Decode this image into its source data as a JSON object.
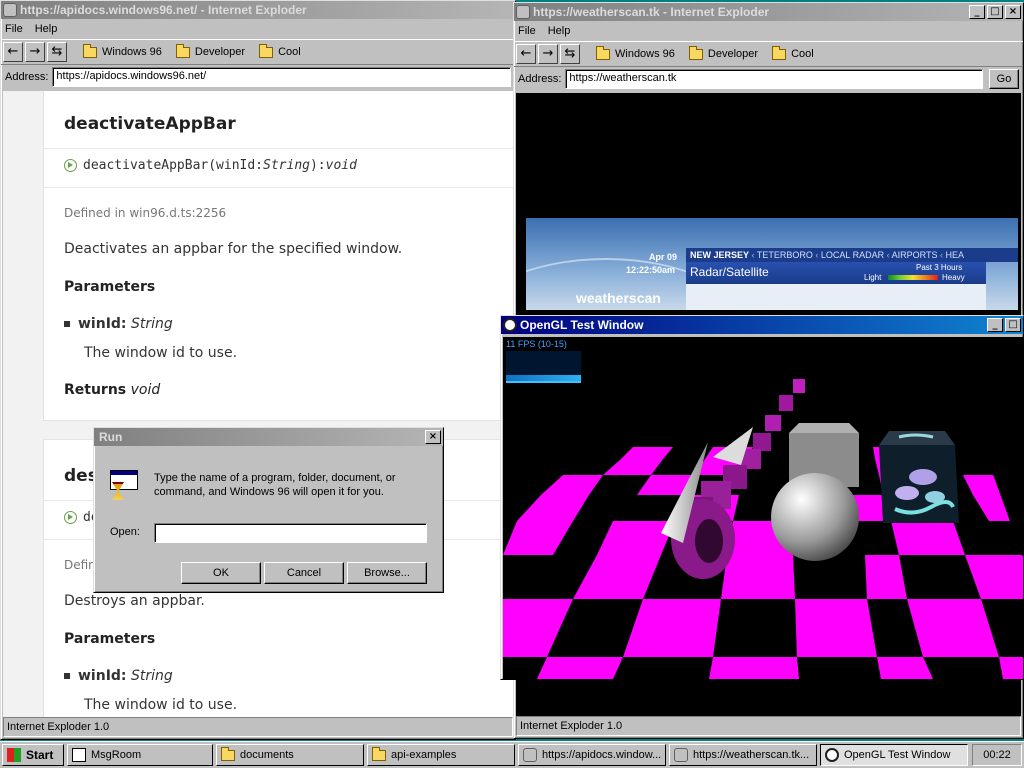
{
  "docs_window": {
    "title": "https://apidocs.windows96.net/ - Internet Exploder",
    "menu": [
      "File",
      "Help"
    ],
    "links": [
      "Windows 96",
      "Developer",
      "Cool"
    ],
    "address_label": "Address:",
    "address": "https://apidocs.windows96.net/",
    "status": "Internet Exploder 1.0",
    "card1": {
      "heading": "deactivateAppBar",
      "sig_name": "deactivateAppBar(winId: ",
      "sig_type": "String",
      "sig_mid": "): ",
      "sig_ret": "void",
      "defined": "Defined in win96.d.ts:2256",
      "desc": "Deactivates an appbar for the specified window.",
      "params_heading": "Parameters",
      "param_name": "winId:",
      "param_type": "String",
      "param_desc": "The window id to use.",
      "returns_label": "Returns",
      "returns_type": "void"
    },
    "card2": {
      "heading_partial": "dest",
      "sig_partial": "de",
      "defined_partial": "Defin",
      "desc": "Destroys an appbar.",
      "params_heading": "Parameters",
      "param_name": "winId:",
      "param_type": "String",
      "param_desc": "The window id to use."
    }
  },
  "weather_window": {
    "title": "https://weatherscan.tk - Internet Exploder",
    "menu": [
      "File",
      "Help"
    ],
    "links": [
      "Windows 96",
      "Developer",
      "Cool"
    ],
    "address_label": "Address:",
    "address": "https://weatherscan.tk",
    "go_label": "Go",
    "status": "Internet Exploder 1.0",
    "banner": {
      "date": "Apr 09",
      "time": "12:22:50am",
      "logo": "weatherscan",
      "location": "NEW JERSEY",
      "crumbs": [
        "TETERBORO",
        "LOCAL RADAR",
        "AIRPORTS",
        "HEA"
      ],
      "panel_title": "Radar/Satellite",
      "past_hours": "Past 3 Hours",
      "light": "Light",
      "heavy": "Heavy"
    }
  },
  "gl_window": {
    "title": "OpenGL Test Window",
    "fps": "11 FPS (10-15)"
  },
  "run_dialog": {
    "title": "Run",
    "message": "Type the name of a program, folder, document, or command, and Windows 96 will open it for you.",
    "open_label": "Open:",
    "open_value": "",
    "ok": "OK",
    "cancel": "Cancel",
    "browse": "Browse..."
  },
  "taskbar": {
    "start": "Start",
    "tasks": [
      "MsgRoom",
      "documents",
      "api-examples",
      "https://apidocs.window...",
      "https://weatherscan.tk...",
      "OpenGL Test Window"
    ],
    "clock": "00:22"
  },
  "colors": {
    "title_active": "#000080",
    "title_inactive": "#808080",
    "checker": "#ff00ff",
    "accent_green": "#6a9f4a"
  }
}
